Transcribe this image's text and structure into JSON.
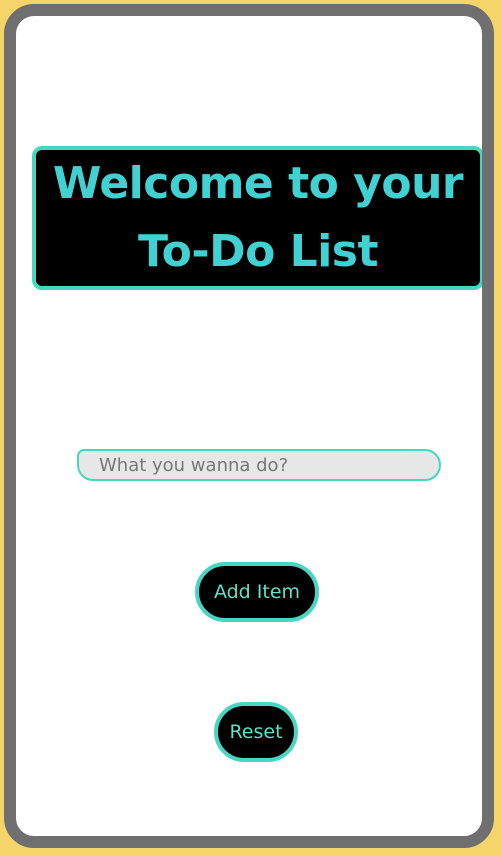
{
  "header": {
    "title_line1": "Welcome to your",
    "title_line2": "To-Do List"
  },
  "form": {
    "input_value": "",
    "input_placeholder": "What you wanna do?",
    "add_label": "Add Item",
    "reset_label": "Reset"
  },
  "colors": {
    "accent": "#46d6c2",
    "title_text": "#41d1d2",
    "button_text": "#5fe0c8",
    "frame": "#6f6f6f",
    "page_bg": "#f5d46a"
  }
}
